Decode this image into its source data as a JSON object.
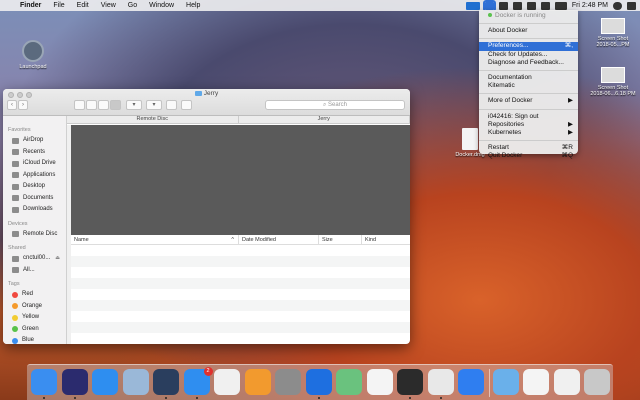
{
  "menubar": {
    "app_name": "Finder",
    "menus": [
      "File",
      "Edit",
      "View",
      "Go",
      "Window",
      "Help"
    ],
    "clock": "Fri 2:48 PM",
    "status_icons": [
      "sap-icon",
      "docker-whale-icon",
      "eye-icon",
      "sync-icon",
      "lock-icon",
      "wifi-icon",
      "battery-icon",
      "search-icon",
      "list-icon"
    ]
  },
  "docker_menu": {
    "status": "Docker is running",
    "items": [
      {
        "label": "About Docker"
      },
      {
        "label": "Preferences...",
        "shortcut": "⌘,"
      },
      {
        "label": "Check for Updates..."
      },
      {
        "label": "Diagnose and Feedback..."
      },
      {
        "label": "Documentation"
      },
      {
        "label": "Kitematic"
      },
      {
        "label": "More of Docker"
      },
      {
        "label": "i042416: Sign out"
      },
      {
        "label": "Repositories"
      },
      {
        "label": "Kubernetes"
      },
      {
        "label": "Restart",
        "shortcut": "⌘R"
      },
      {
        "label": "Quit Docker",
        "shortcut": "⌘Q"
      }
    ]
  },
  "desktop": {
    "launchpad": "Launchpad",
    "docker_dmg": "Docker.dmg",
    "shot1_line1": "Screen Shot",
    "shot1_line2": "2018-05...PM",
    "shot2_line1": "Screen Shot",
    "shot2_line2": "2018-06...6.18 PM"
  },
  "finder": {
    "title": "Jerry",
    "search_placeholder": "Search",
    "path": [
      "Remote Disc",
      "Jerry"
    ],
    "sidebar": {
      "favorites_header": "Favorites",
      "favorites": [
        "AirDrop",
        "Recents",
        "iCloud Drive",
        "Applications",
        "Desktop",
        "Documents",
        "Downloads"
      ],
      "devices_header": "Devices",
      "devices": [
        "Remote Disc"
      ],
      "shared_header": "Shared",
      "shared": [
        "cnctul00...",
        "All..."
      ],
      "tags_header": "Tags",
      "tags": [
        {
          "label": "Red",
          "color": "#f0493f"
        },
        {
          "label": "Orange",
          "color": "#f59a2c"
        },
        {
          "label": "Yellow",
          "color": "#f2cc31"
        },
        {
          "label": "Green",
          "color": "#58c24a"
        },
        {
          "label": "Blue",
          "color": "#3a8ef0"
        }
      ]
    },
    "columns": {
      "name": "Name",
      "date": "Date Modified",
      "size": "Size",
      "kind": "Kind"
    }
  },
  "dock": {
    "badge_count": "2",
    "apps": [
      {
        "name": "finder-icon",
        "color": "#3a8ef0"
      },
      {
        "name": "siri-icon",
        "color": "#2b2b6e"
      },
      {
        "name": "safari-icon",
        "color": "#2e8ef0"
      },
      {
        "name": "preview-icon",
        "color": "#9ab8d8"
      },
      {
        "name": "screen-sharing-icon",
        "color": "#2a3e5e"
      },
      {
        "name": "app-store-icon",
        "color": "#2f8ef0"
      },
      {
        "name": "itunes-icon",
        "color": "#f0f0f0"
      },
      {
        "name": "ibooks-icon",
        "color": "#f29a2e"
      },
      {
        "name": "system-preferences-icon",
        "color": "#8c8c8c"
      },
      {
        "name": "teamviewer-icon",
        "color": "#1e6fe0"
      },
      {
        "name": "maps-icon",
        "color": "#6ac27e"
      },
      {
        "name": "photos-icon",
        "color": "#f4f4f4"
      },
      {
        "name": "terminal-icon",
        "color": "#2b2b2b"
      },
      {
        "name": "chrome-icon",
        "color": "#e8e8e8"
      },
      {
        "name": "pencil-app-icon",
        "color": "#2f7ef0"
      },
      {
        "name": "applications-folder-icon",
        "color": "#6ab0ea"
      },
      {
        "name": "document-icon",
        "color": "#f4f4f4"
      },
      {
        "name": "docker-dmg-icon",
        "color": "#f0f0f0"
      },
      {
        "name": "trash-icon",
        "color": "#c8c8c8"
      }
    ]
  }
}
